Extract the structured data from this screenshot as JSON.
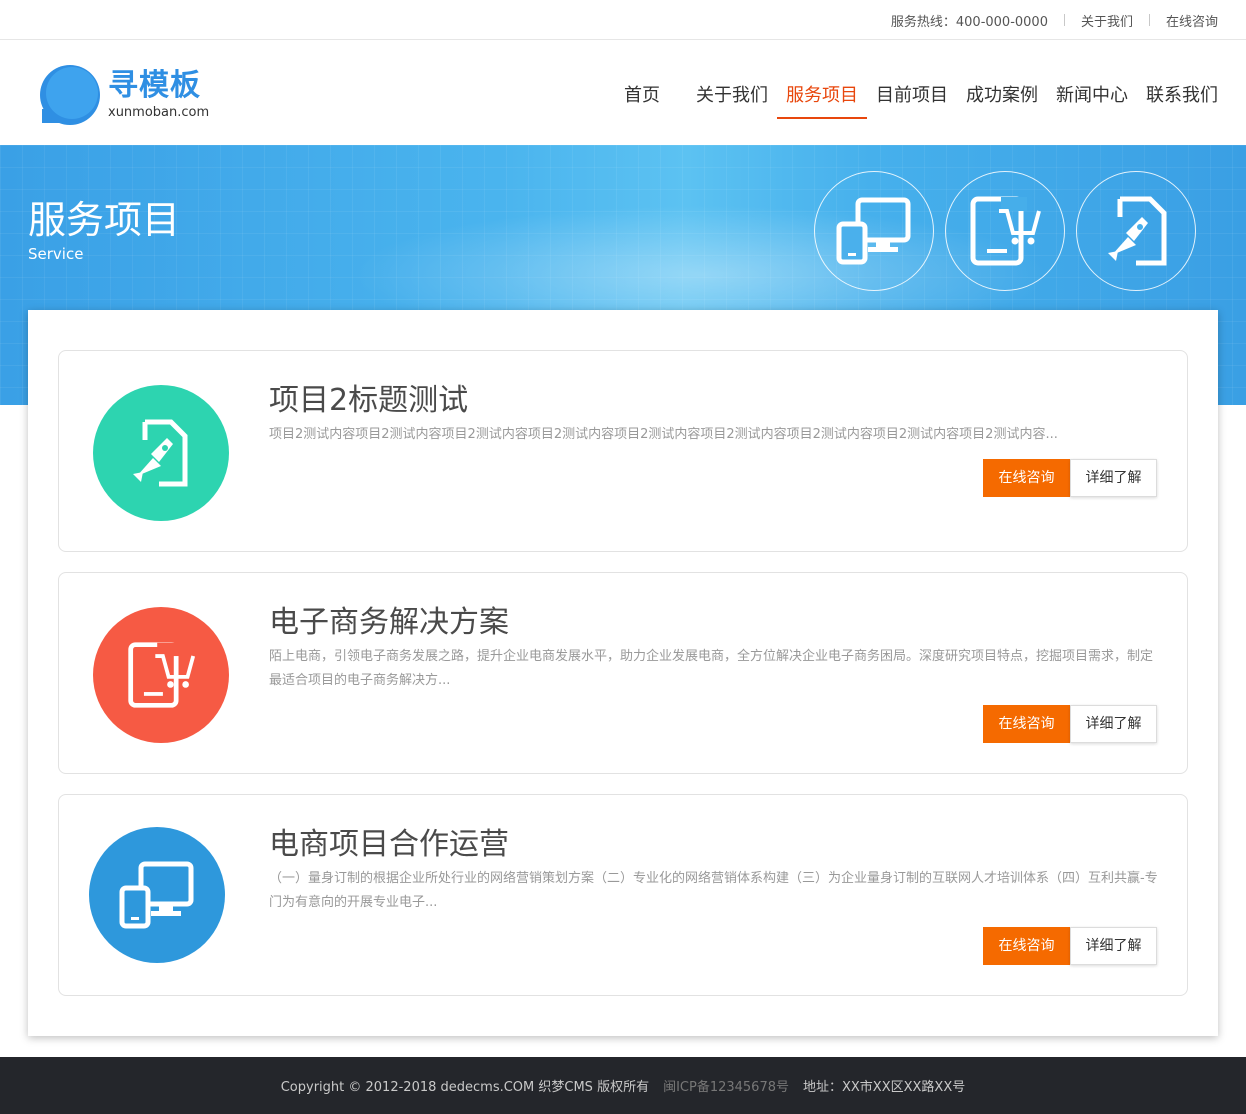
{
  "topbar": {
    "hotline": "服务热线：400-000-0000",
    "about": "关于我们",
    "consult": "在线咨询"
  },
  "logo": {
    "cn": "寻模板",
    "en": "xunmoban.com"
  },
  "nav": {
    "items": [
      "首页",
      "关于我们",
      "服务项目",
      "目前项目",
      "成功案例",
      "新闻中心",
      "联系我们"
    ],
    "active": "服务项目"
  },
  "banner": {
    "title": "服务项目",
    "subtitle": "Service",
    "icons": [
      "devices-icon",
      "tablet-cart-icon",
      "rocket-doc-icon"
    ]
  },
  "items": [
    {
      "title": "项目2标题测试",
      "desc": "项目2测试内容项目2测试内容项目2测试内容项目2测试内容项目2测试内容项目2测试内容项目2测试内容项目2测试内容项目2测试内容...",
      "icon": "rocket-doc-icon",
      "color": "#2dd4b0",
      "btn_consult": "在线咨询",
      "btn_detail": "详细了解"
    },
    {
      "title": "电子商务解决方案",
      "desc": "陌上电商，引领电子商务发展之路，提升企业电商发展水平，助力企业发展电商，全方位解决企业电子商务困局。深度研究项目特点，挖掘项目需求，制定最适合项目的电子商务解决方...",
      "icon": "tablet-cart-icon",
      "color": "#f65a44",
      "btn_consult": "在线咨询",
      "btn_detail": "详细了解"
    },
    {
      "title": "电商项目合作运营",
      "desc": "（一）量身订制的根据企业所处行业的网络营销策划方案（二）专业化的网络营销体系构建（三）为企业量身订制的互联网人才培训体系（四）互利共赢-专门为有意向的开展专业电子...",
      "icon": "devices-icon",
      "color": "#2e98dc",
      "btn_consult": "在线咨询",
      "btn_detail": "详细了解"
    }
  ],
  "footer": {
    "copyright": "Copyright © 2012-2018 dedecms.COM 织梦CMS 版权所有",
    "icp": "闽ICP备12345678号",
    "address": "地址：XX市XX区XX路XX号"
  }
}
